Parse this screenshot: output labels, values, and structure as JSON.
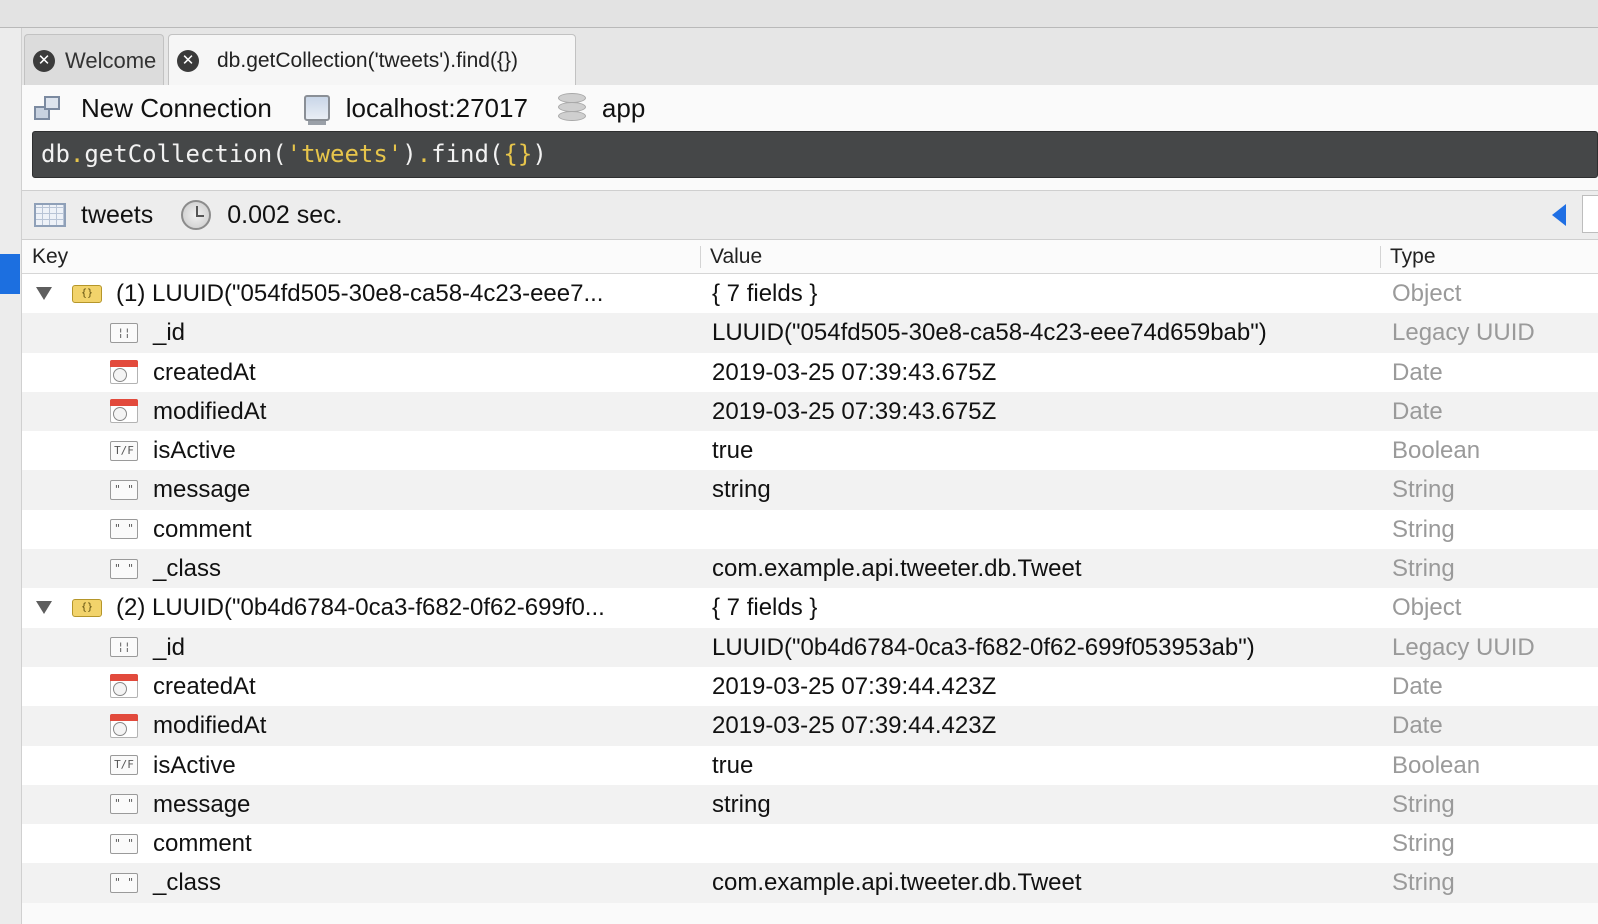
{
  "tabs": [
    {
      "label": "Welcome",
      "close": "✕"
    },
    {
      "label": "db.getCollection('tweets').find({})",
      "close": "✕"
    }
  ],
  "connection": {
    "new_connection": "New Connection",
    "host": "localhost:27017",
    "database": "app"
  },
  "query": {
    "prefix": "db",
    "dot1": ".",
    "method1": "getCollection(",
    "arg": "'tweets'",
    "close1": ")",
    "dot2": ".",
    "method2": "find(",
    "arg2": "{}",
    "close2": ")"
  },
  "results": {
    "collection": "tweets",
    "elapsed": "0.002 sec."
  },
  "columns": {
    "key": "Key",
    "value": "Value",
    "type": "Type"
  },
  "icons": {
    "object": "object-icon",
    "uuid": "uuid-icon",
    "date": "date-icon",
    "bool": "boolean-icon",
    "string": "string-icon"
  },
  "documents": [
    {
      "key": "(1) LUUID(\"054fd505-30e8-ca58-4c23-eee7...",
      "value": "{ 7 fields }",
      "type": "Object",
      "fields": [
        {
          "key": "_id",
          "value": "LUUID(\"054fd505-30e8-ca58-4c23-eee74d659bab\")",
          "type": "Legacy UUID",
          "icon": "uuid"
        },
        {
          "key": "createdAt",
          "value": "2019-03-25 07:39:43.675Z",
          "type": "Date",
          "icon": "date"
        },
        {
          "key": "modifiedAt",
          "value": "2019-03-25 07:39:43.675Z",
          "type": "Date",
          "icon": "date"
        },
        {
          "key": "isActive",
          "value": "true",
          "type": "Boolean",
          "icon": "bool"
        },
        {
          "key": "message",
          "value": "string",
          "type": "String",
          "icon": "string"
        },
        {
          "key": "comment",
          "value": "",
          "type": "String",
          "icon": "string"
        },
        {
          "key": "_class",
          "value": "com.example.api.tweeter.db.Tweet",
          "type": "String",
          "icon": "string"
        }
      ]
    },
    {
      "key": "(2) LUUID(\"0b4d6784-0ca3-f682-0f62-699f0...",
      "value": "{ 7 fields }",
      "type": "Object",
      "fields": [
        {
          "key": "_id",
          "value": "LUUID(\"0b4d6784-0ca3-f682-0f62-699f053953ab\")",
          "type": "Legacy UUID",
          "icon": "uuid"
        },
        {
          "key": "createdAt",
          "value": "2019-03-25 07:39:44.423Z",
          "type": "Date",
          "icon": "date"
        },
        {
          "key": "modifiedAt",
          "value": "2019-03-25 07:39:44.423Z",
          "type": "Date",
          "icon": "date"
        },
        {
          "key": "isActive",
          "value": "true",
          "type": "Boolean",
          "icon": "bool"
        },
        {
          "key": "message",
          "value": "string",
          "type": "String",
          "icon": "string"
        },
        {
          "key": "comment",
          "value": "",
          "type": "String",
          "icon": "string"
        },
        {
          "key": "_class",
          "value": "com.example.api.tweeter.db.Tweet",
          "type": "String",
          "icon": "string"
        }
      ]
    }
  ]
}
